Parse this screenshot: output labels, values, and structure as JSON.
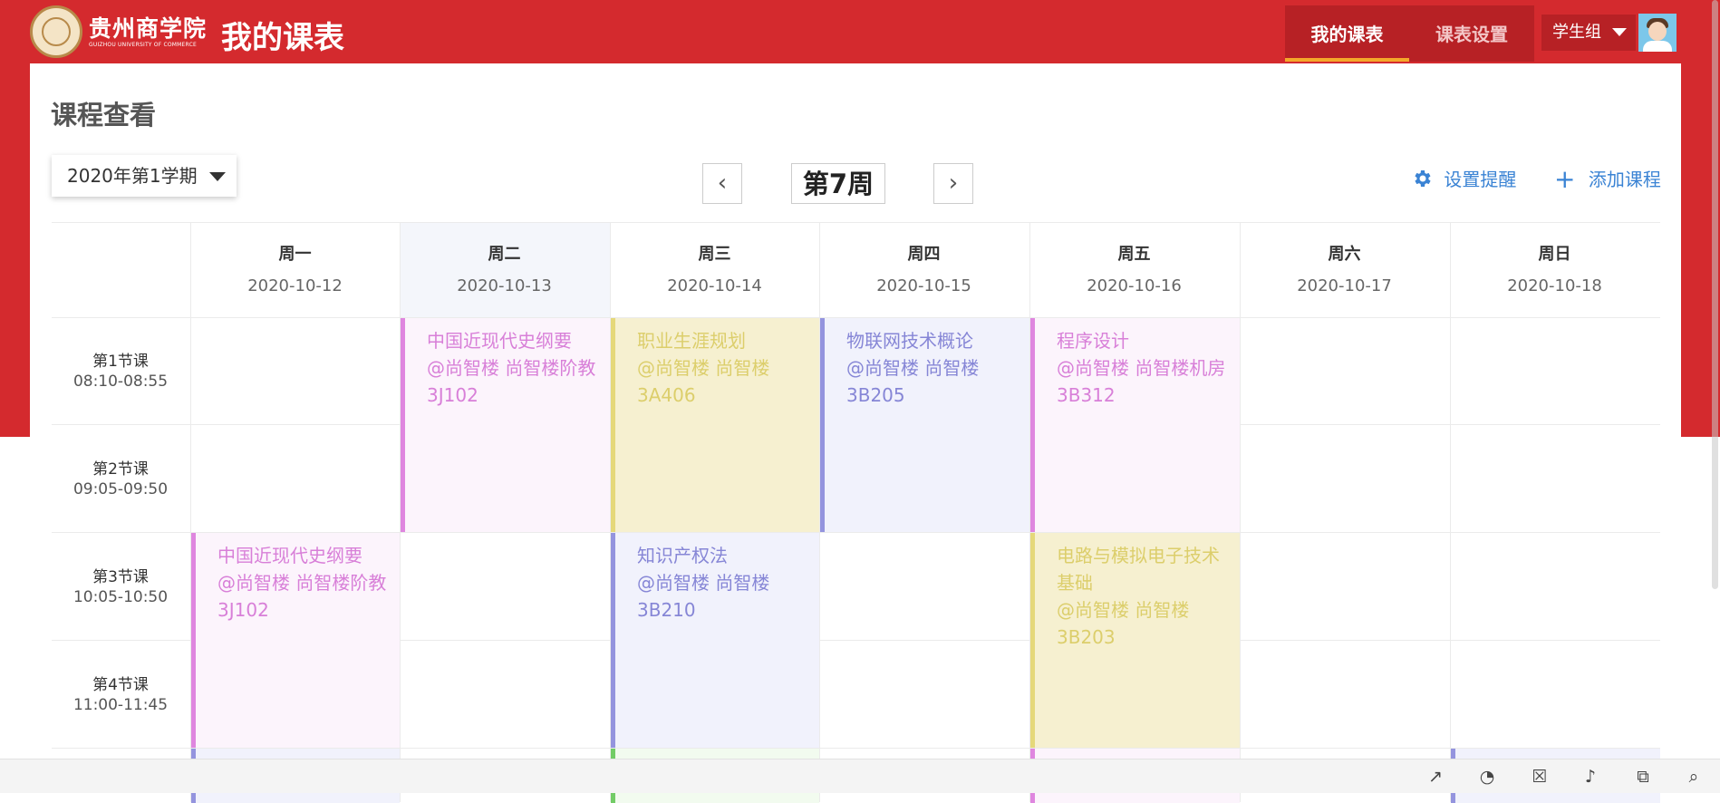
{
  "header": {
    "school_name": "贵州商学院",
    "school_name_en": "GUIZHOU UNIVERSITY OF COMMERCE",
    "app_title": "我的课表",
    "nav": [
      {
        "label": "我的课表",
        "active": true
      },
      {
        "label": "课表设置",
        "active": false
      }
    ],
    "role": "学生组",
    "colors": {
      "brand_red": "#d42a2e",
      "nav_dark": "#b72125",
      "active_underline": "#f4a72a"
    }
  },
  "page": {
    "title": "课程查看",
    "semester": "2020年第1学期",
    "week_label": "第7周",
    "prev_icon": "chevron-left-icon",
    "next_icon": "chevron-right-icon",
    "actions": {
      "reminder_label": "设置提醒",
      "reminder_icon": "gear-icon",
      "add_label": "添加课程",
      "add_icon": "plus-icon"
    },
    "accent": "#3a83d4"
  },
  "days": [
    {
      "name": "周一",
      "date": "2020-10-12"
    },
    {
      "name": "周二",
      "date": "2020-10-13"
    },
    {
      "name": "周三",
      "date": "2020-10-14"
    },
    {
      "name": "周四",
      "date": "2020-10-15"
    },
    {
      "name": "周五",
      "date": "2020-10-16"
    },
    {
      "name": "周六",
      "date": "2020-10-17"
    },
    {
      "name": "周日",
      "date": "2020-10-18"
    }
  ],
  "periods": [
    {
      "name": "第1节课",
      "time": "08:10-08:55"
    },
    {
      "name": "第2节课",
      "time": "09:05-09:50"
    },
    {
      "name": "第3节课",
      "time": "10:05-10:50"
    },
    {
      "name": "第4节课",
      "time": "11:00-11:45"
    }
  ],
  "courses": [
    {
      "day": "周二",
      "periods": "1-2",
      "title": "中国近现代史纲要",
      "location": "@尚智楼 尚智楼阶教",
      "room": "3J102",
      "color": "pink"
    },
    {
      "day": "周三",
      "periods": "1-2",
      "title": "职业生涯规划",
      "location": "@尚智楼 尚智楼",
      "room": "3A406",
      "color": "yellow"
    },
    {
      "day": "周四",
      "periods": "1-2",
      "title": "物联网技术概论",
      "location": "@尚智楼 尚智楼",
      "room": "3B205",
      "color": "blue"
    },
    {
      "day": "周五",
      "periods": "1-2",
      "title": "程序设计",
      "location": "@尚智楼 尚智楼机房",
      "room": "3B312",
      "color": "pink"
    },
    {
      "day": "周一",
      "periods": "3-4",
      "title": "中国近现代史纲要",
      "location": "@尚智楼 尚智楼阶教",
      "room": "3J102",
      "color": "pink"
    },
    {
      "day": "周三",
      "periods": "3-4",
      "title": "知识产权法",
      "location": "@尚智楼 尚智楼",
      "room": "3B210",
      "color": "blue"
    },
    {
      "day": "周五",
      "periods": "3-4",
      "title": "电路与模拟电子技术基础",
      "location": "@尚智楼 尚智楼",
      "room": "3B203",
      "color": "yellow"
    }
  ],
  "toolbar": {
    "icons": [
      "rocket-icon",
      "speed-icon",
      "trash-icon",
      "speaker-icon",
      "window-icon",
      "search-icon"
    ]
  }
}
